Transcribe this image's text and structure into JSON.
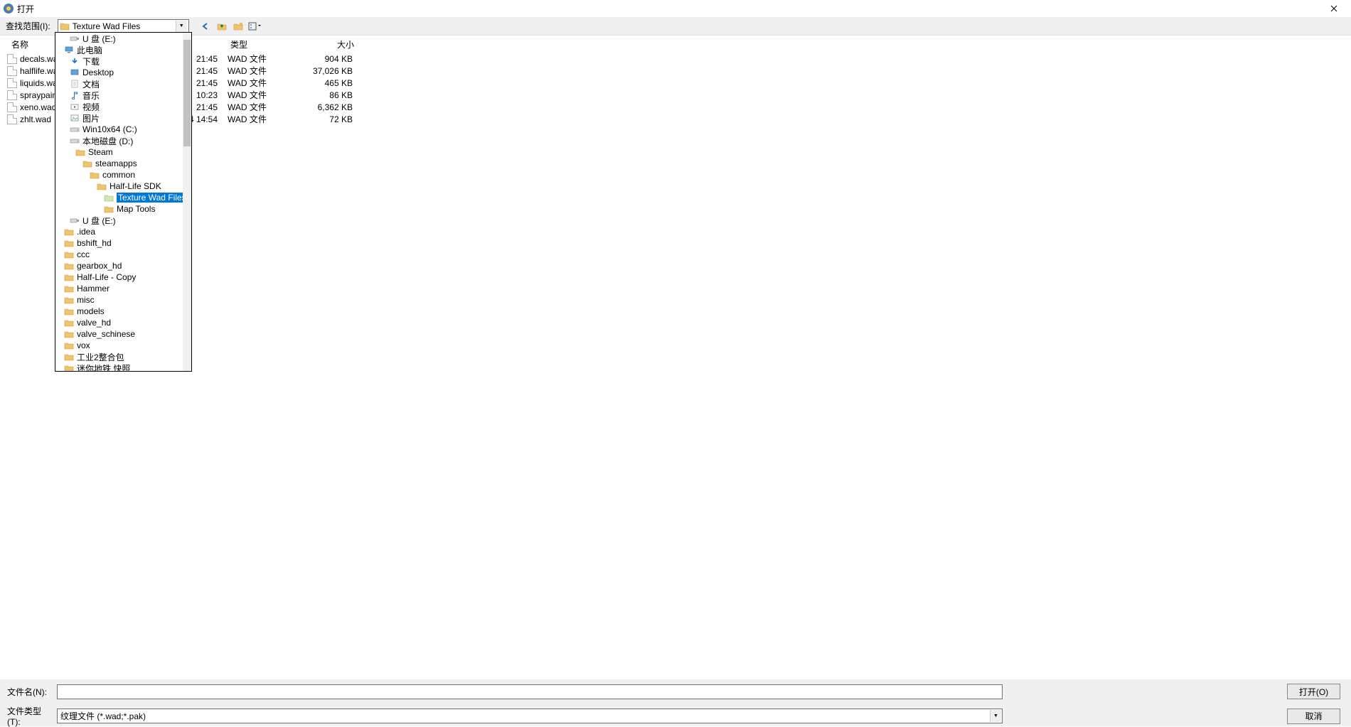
{
  "window": {
    "title": "打开",
    "close_tooltip": "关闭"
  },
  "toolbar": {
    "lookin_label": "查找范围(I):",
    "lookin_value": "Texture Wad Files",
    "back_tooltip": "返回",
    "up_tooltip": "向上一级",
    "newfolder_tooltip": "新建文件夹",
    "views_tooltip": "视图"
  },
  "columns": {
    "name": "名称",
    "type": "类型",
    "size": "大小"
  },
  "files": [
    {
      "name": "decals.wad",
      "time": "21:45",
      "type": "WAD 文件",
      "size": "904 KB"
    },
    {
      "name": "halflife.wad",
      "time": "21:45",
      "type": "WAD 文件",
      "size": "37,026 KB"
    },
    {
      "name": "liquids.wad",
      "time": "21:45",
      "type": "WAD 文件",
      "size": "465 KB"
    },
    {
      "name": "spraypaint.wad",
      "time": "10:23",
      "type": "WAD 文件",
      "size": "86 KB"
    },
    {
      "name": "xeno.wad",
      "time": "21:45",
      "type": "WAD 文件",
      "size": "6,362 KB"
    },
    {
      "name": "zhlt.wad",
      "time": "4 14:54",
      "type": "WAD 文件",
      "size": "72 KB"
    }
  ],
  "tree": [
    {
      "indent": 1,
      "icon": "usb",
      "label": "U 盘 (E:)"
    },
    {
      "indent": 0,
      "icon": "pc",
      "label": "此电脑"
    },
    {
      "indent": 1,
      "icon": "down",
      "label": "下载"
    },
    {
      "indent": 1,
      "icon": "desktop",
      "label": "Desktop"
    },
    {
      "indent": 1,
      "icon": "doc",
      "label": "文档"
    },
    {
      "indent": 1,
      "icon": "music",
      "label": "音乐"
    },
    {
      "indent": 1,
      "icon": "video",
      "label": "视频"
    },
    {
      "indent": 1,
      "icon": "pic",
      "label": "图片"
    },
    {
      "indent": 1,
      "icon": "drive",
      "label": "Win10x64 (C:)"
    },
    {
      "indent": 1,
      "icon": "drive",
      "label": "本地磁盘 (D:)"
    },
    {
      "indent": 2,
      "icon": "folder",
      "label": "Steam"
    },
    {
      "indent": 3,
      "icon": "folder",
      "label": "steamapps"
    },
    {
      "indent": 4,
      "icon": "folder",
      "label": "common"
    },
    {
      "indent": 5,
      "icon": "folder",
      "label": "Half-Life SDK"
    },
    {
      "indent": 6,
      "icon": "foldersel",
      "label": "Texture Wad Files",
      "selected": true
    },
    {
      "indent": 6,
      "icon": "folder",
      "label": "Map Tools"
    },
    {
      "indent": 1,
      "icon": "usb",
      "label": "U 盘 (E:)"
    },
    {
      "indent": 0,
      "icon": "folder",
      "label": ".idea"
    },
    {
      "indent": 0,
      "icon": "folder",
      "label": "bshift_hd"
    },
    {
      "indent": 0,
      "icon": "folder",
      "label": "ccc"
    },
    {
      "indent": 0,
      "icon": "folder",
      "label": "gearbox_hd"
    },
    {
      "indent": 0,
      "icon": "folder",
      "label": "Half-Life - Copy"
    },
    {
      "indent": 0,
      "icon": "folder",
      "label": "Hammer"
    },
    {
      "indent": 0,
      "icon": "folder",
      "label": "misc"
    },
    {
      "indent": 0,
      "icon": "folder",
      "label": "models"
    },
    {
      "indent": 0,
      "icon": "folder",
      "label": "valve_hd"
    },
    {
      "indent": 0,
      "icon": "folder",
      "label": "valve_schinese"
    },
    {
      "indent": 0,
      "icon": "folder",
      "label": "vox"
    },
    {
      "indent": 0,
      "icon": "folder",
      "label": "工业2整合包"
    },
    {
      "indent": 0,
      "icon": "folder",
      "label": "迷你地铁 快照"
    }
  ],
  "bottom": {
    "filename_label": "文件名(N):",
    "filename_value": "",
    "filetype_label": "文件类型(T):",
    "filetype_value": "纹理文件 (*.wad;*.pak)",
    "open_label": "打开(O)",
    "cancel_label": "取消"
  }
}
